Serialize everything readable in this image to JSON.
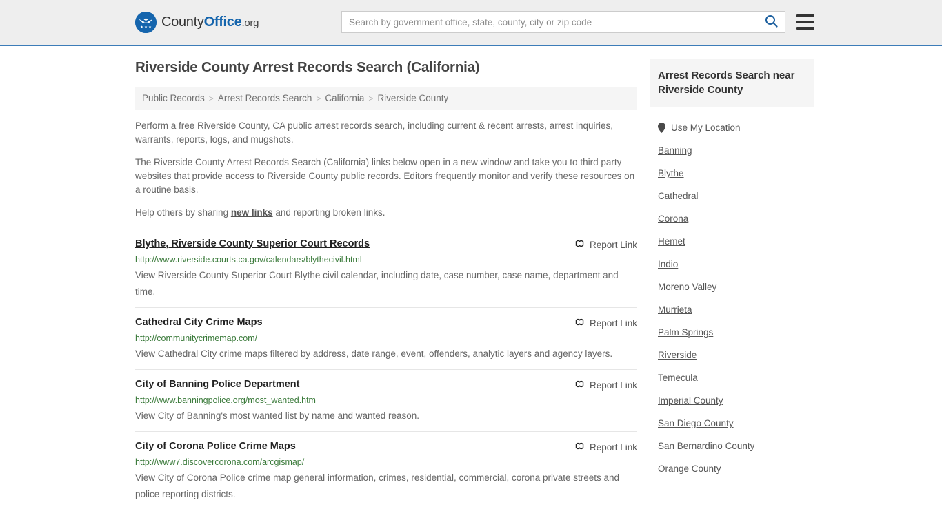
{
  "header": {
    "logo": {
      "icon": "eagle-shield-logo-icon",
      "text_county": "County",
      "text_office": "Office",
      "text_tld": ".org"
    },
    "search": {
      "placeholder": "Search by government office, state, county, city or zip code",
      "value": "",
      "search_icon": "search-icon"
    },
    "menu_icon": "hamburger-menu-icon"
  },
  "main": {
    "page_title": "Riverside County Arrest Records Search (California)",
    "breadcrumb": {
      "separator": ">",
      "items": [
        {
          "label": "Public Records"
        },
        {
          "label": "Arrest Records Search"
        },
        {
          "label": "California"
        },
        {
          "label": "Riverside County"
        }
      ]
    },
    "intro": {
      "paragraph1": "Perform a free Riverside County, CA public arrest records search, including current & recent arrests, arrest inquiries, warrants, reports, logs, and mugshots.",
      "paragraph2": "The Riverside County Arrest Records Search (California) links below open in a new window and take you to third party websites that provide access to Riverside County public records. Editors frequently monitor and verify these resources on a routine basis.",
      "paragraph3_prefix": "Help others by sharing ",
      "paragraph3_link": "new links",
      "paragraph3_suffix": " and reporting broken links."
    },
    "report_link_label": "Report Link",
    "report_link_icon": "broken-link-icon",
    "results": [
      {
        "title": "Blythe, Riverside County Superior Court Records",
        "url": "http://www.riverside.courts.ca.gov/calendars/blythecivil.html",
        "description": "View Riverside County Superior Court Blythe civil calendar, including date, case number, case name, department and time."
      },
      {
        "title": "Cathedral City Crime Maps",
        "url": "http://communitycrimemap.com/",
        "description": "View Cathedral City crime maps filtered by address, date range, event, offenders, analytic layers and agency layers."
      },
      {
        "title": "City of Banning Police Department",
        "url": "http://www.banningpolice.org/most_wanted.htm",
        "description": "View City of Banning's most wanted list by name and wanted reason."
      },
      {
        "title": "City of Corona Police Crime Maps",
        "url": "http://www7.discovercorona.com/arcgismap/",
        "description": "View City of Corona Police crime map general information, crimes, residential, commercial, corona private streets and police reporting districts."
      }
    ]
  },
  "sidebar": {
    "title": "Arrest Records Search near Riverside County",
    "location_icon": "map-pin-icon",
    "items": [
      {
        "label": "Use My Location",
        "icon": "map-pin-icon"
      },
      {
        "label": "Banning"
      },
      {
        "label": "Blythe"
      },
      {
        "label": "Cathedral"
      },
      {
        "label": "Corona"
      },
      {
        "label": "Hemet"
      },
      {
        "label": "Indio"
      },
      {
        "label": "Moreno Valley"
      },
      {
        "label": "Murrieta"
      },
      {
        "label": "Palm Springs"
      },
      {
        "label": "Riverside"
      },
      {
        "label": "Temecula"
      },
      {
        "label": "Imperial County"
      },
      {
        "label": "San Diego County"
      },
      {
        "label": "San Bernardino County"
      },
      {
        "label": "Orange County"
      }
    ]
  },
  "colors": {
    "header_bg": "#eeeeee",
    "header_border": "#3d7cb8",
    "brand_blue": "#1565ad",
    "url_green": "#3a7a3a",
    "panel_gray": "#f5f5f5"
  }
}
